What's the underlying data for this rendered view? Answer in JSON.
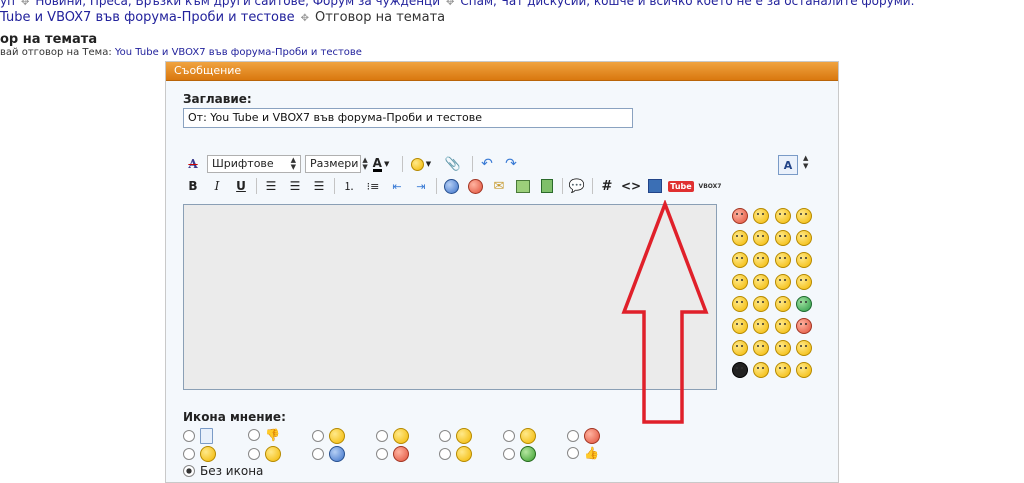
{
  "breadcrumbs_top": {
    "text_a": "уп",
    "link1": "Новини, Преса, Връзки към други сайтове, Форум за чужденци",
    "link2": "Спам, Чат дискусии, кошче и всичко което не е за останалите форуми."
  },
  "breadcrumbs": {
    "thread": "Tube и VBOX7 във форума-Проби и тестове",
    "current": "Отговор на темата"
  },
  "page": {
    "title": "ор на темата",
    "subtitle_prefix": "вай отговор на Тема: ",
    "subtitle_link": "You Tube и VBOX7 във форума-Проби и тестове"
  },
  "panel": {
    "header": "Съобщение",
    "title_label": "Заглавие:",
    "title_value": "От: You Tube и VBOX7 във форума-Проби и тестове"
  },
  "toolbar": {
    "font_select": "Шрифтове",
    "size_select": "Размери",
    "bold": "B",
    "italic": "I",
    "underline": "U",
    "hash": "#",
    "code": "<>",
    "youtube": "Tube",
    "vbox7": "VBOX7"
  },
  "post_icons": {
    "title": "Икона мнение:",
    "no_icon_label": "Без икона"
  },
  "colors": {
    "header_orange": "#e08a1e",
    "arrow_red": "#e0202a",
    "link_blue": "#22229c"
  }
}
